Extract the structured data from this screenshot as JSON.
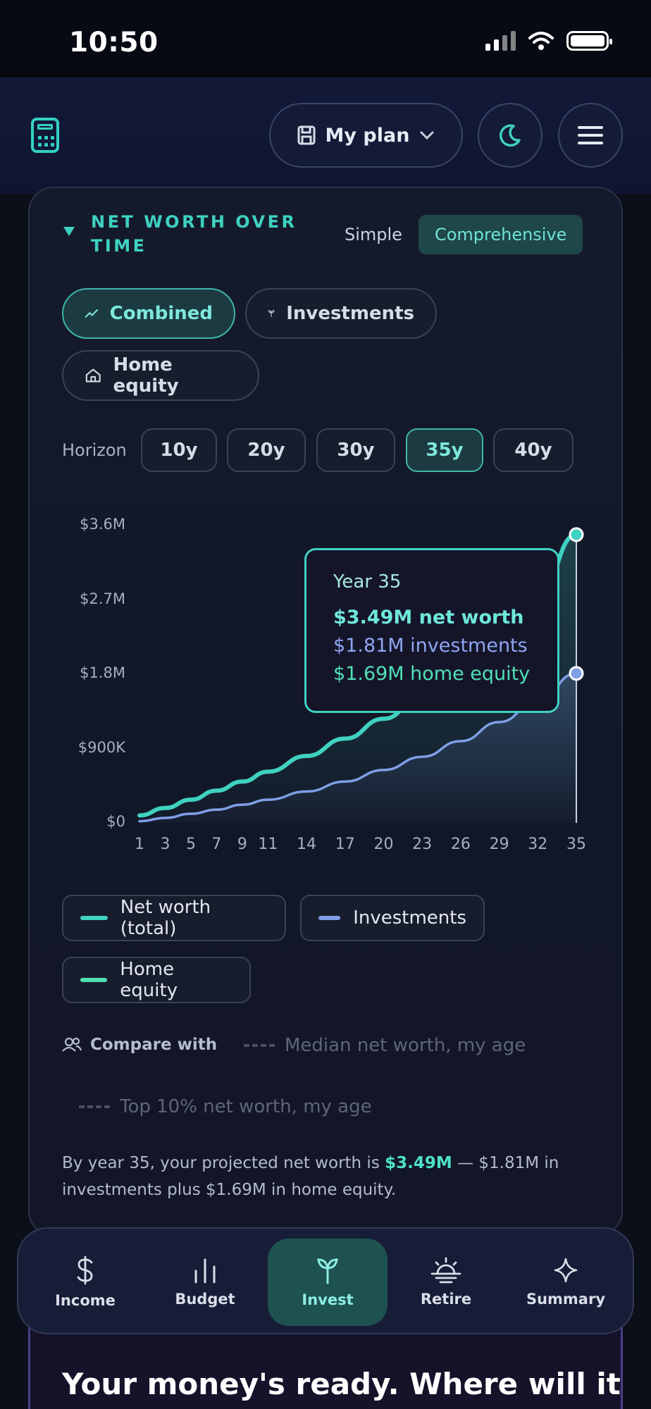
{
  "status_bar": {
    "time": "10:50"
  },
  "header": {
    "plan_label": "My plan"
  },
  "card": {
    "title": "NET WORTH OVER TIME",
    "mode_options": [
      "Simple",
      "Comprehensive"
    ],
    "mode_selected": "Comprehensive",
    "view_pills": [
      {
        "label": "Combined",
        "icon": "trend-line-icon",
        "selected": true
      },
      {
        "label": "Investments",
        "icon": "sprout-icon",
        "selected": false
      },
      {
        "label": "Home equity",
        "icon": "home-icon",
        "selected": false
      }
    ],
    "horizon_label": "Horizon",
    "horizons": [
      "10y",
      "20y",
      "30y",
      "35y",
      "40y"
    ],
    "horizon_selected": "35y",
    "tooltip": {
      "year": "Year 35",
      "net_worth": "$3.49M net worth",
      "investments": "$1.81M investments",
      "home_equity": "$1.69M home equity"
    },
    "legend": [
      {
        "label": "Net worth (total)",
        "color": "#3fd1c1"
      },
      {
        "label": "Investments",
        "color": "#7f9fe6"
      },
      {
        "label": "Home equity",
        "color": "#4fe0b5"
      }
    ],
    "compare_label": "Compare with",
    "compare_options": [
      "Median net worth, my age",
      "Top 10% net worth, my age"
    ],
    "summary": {
      "prefix": "By year 35, your projected net worth is",
      "highlight": "$3.49M",
      "suffix": "— $1.81M in investments plus $1.69M in home equity."
    }
  },
  "chart_data": {
    "type": "line",
    "y_tick_labels": [
      "$3.6M",
      "$2.7M",
      "$1.8M",
      "$900K",
      "$0"
    ],
    "ylim": [
      0,
      3600000
    ],
    "x_tick_labels": [
      "1",
      "3",
      "5",
      "7",
      "9",
      "11",
      "14",
      "17",
      "20",
      "23",
      "26",
      "29",
      "32",
      "35"
    ],
    "x": [
      1,
      3,
      5,
      7,
      9,
      11,
      14,
      17,
      20,
      23,
      26,
      29,
      32,
      35
    ],
    "series": [
      {
        "name": "Net worth (total)",
        "color": "#3fd1c1",
        "values": [
          90000,
          180000,
          280000,
          390000,
          500000,
          620000,
          810000,
          1020000,
          1260000,
          1540000,
          1870000,
          2260000,
          2750000,
          3490000
        ]
      },
      {
        "name": "Investments",
        "color": "#7f9fe6",
        "values": [
          20000,
          60000,
          110000,
          160000,
          220000,
          280000,
          380000,
          500000,
          640000,
          800000,
          990000,
          1220000,
          1480000,
          1810000
        ]
      }
    ],
    "highlight_x": 35
  },
  "nav": {
    "items": [
      {
        "label": "Income",
        "icon": "dollar-icon"
      },
      {
        "label": "Budget",
        "icon": "bar-chart-icon"
      },
      {
        "label": "Invest",
        "icon": "sprout-icon"
      },
      {
        "label": "Retire",
        "icon": "sunset-icon"
      },
      {
        "label": "Summary",
        "icon": "sparkle-icon"
      }
    ],
    "selected": "Invest"
  },
  "next_card": {
    "title": "Your money's ready. Where will it"
  }
}
